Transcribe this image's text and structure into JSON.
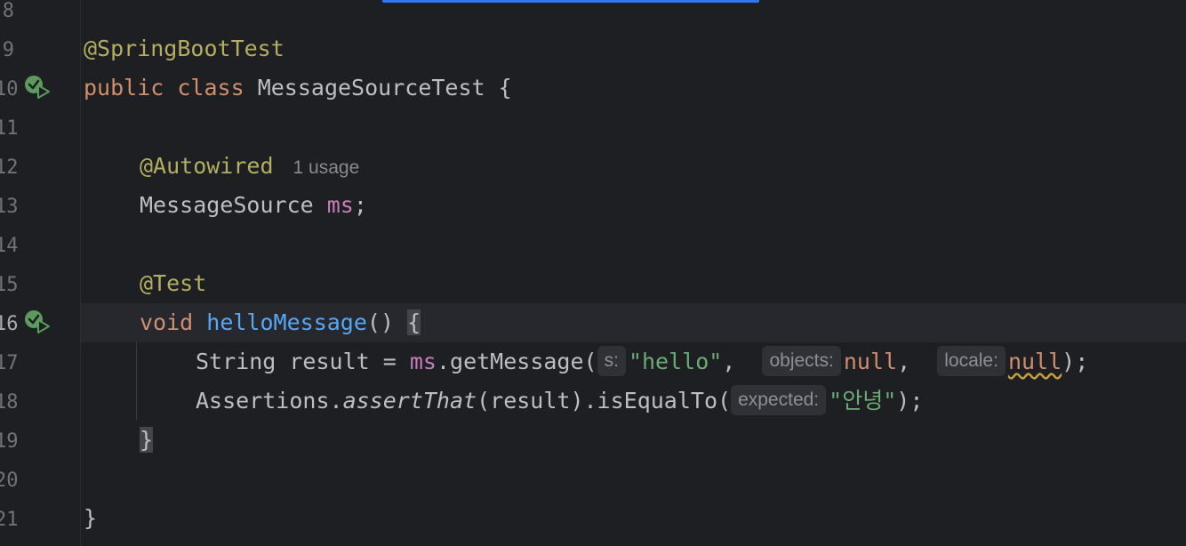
{
  "editor": {
    "line_numbers": [
      "8",
      "9",
      "10",
      "11",
      "12",
      "13",
      "14",
      "15",
      "16",
      "17",
      "18",
      "19",
      "20",
      "21"
    ],
    "tokens": {
      "springboottest": "@SpringBootTest",
      "public": "public",
      "class": "class",
      "class_name": "MessageSourceTest",
      "open_brace": "{",
      "autowired": "@Autowired",
      "usage_hint": "1 usage",
      "messagesource_type": "MessageSource",
      "ms": "ms",
      "semicolon": ";",
      "test_ann": "@Test",
      "void": "void",
      "method_name": "helloMessage",
      "parens": "()",
      "string_type": "String",
      "result_assign": "result =",
      "ms_ref": "ms",
      "get_message": ".getMessage(",
      "hint_s": "s:",
      "hello_str": "\"hello\"",
      "comma1": ",",
      "hint_objects": "objects:",
      "null1": "null",
      "comma2": ",",
      "hint_locale": "locale:",
      "null2": "null",
      "close_stmt1": ");",
      "assertions": "Assertions.",
      "assert_that": "assertThat",
      "result_arg": "(result).isEqualTo(",
      "hint_expected": "expected:",
      "annyeong_str": "\"안녕\"",
      "close_stmt2": ");",
      "close_method_brace": "}",
      "close_class_brace": "}"
    }
  },
  "colors": {
    "background": "#1e1f22",
    "keyword": "#cf8e6d",
    "annotation": "#b3ae60",
    "string": "#6aab73",
    "method": "#56a8f5",
    "field": "#c77dbb",
    "accent": "#3574f0"
  },
  "icons": [
    "run-test-icon"
  ]
}
